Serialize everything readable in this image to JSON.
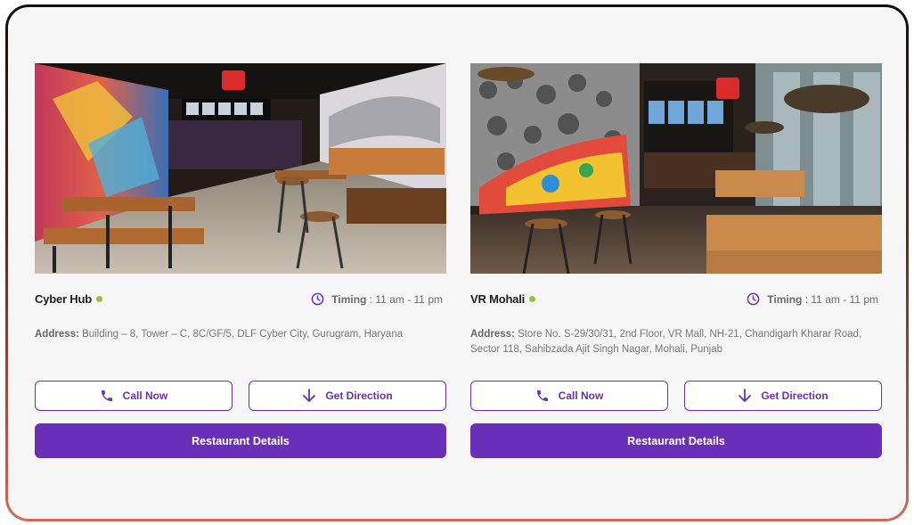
{
  "colors": {
    "accent": "#6a2fb8",
    "status_open": "#8cc63f",
    "card_bg": "#f6f6f6"
  },
  "stores": [
    {
      "name": "Cyber Hub",
      "timing_label": "Timing",
      "timing_value": ": 11 am - 11 pm",
      "address_label": "Address:",
      "address": "Building – 8, Tower – C, 8C/GF/5, DLF Cyber City, Gurugram, Haryana",
      "call_label": "Call Now",
      "direction_label": "Get Direction",
      "details_label": "Restaurant Details",
      "icons": {
        "call": "phone-icon",
        "direction": "arrow-down-icon",
        "timing": "clock-icon"
      }
    },
    {
      "name": "VR Mohali",
      "timing_label": "Timing",
      "timing_value": ": 11 am - 11 pm",
      "address_label": "Address:",
      "address": "Store No. S-29/30/31, 2nd Floor, VR Mall, NH-21, Chandigarh Kharar Road, Sector 118, Sahibzada Ajit Singh Nagar, Mohali, Punjab",
      "call_label": "Call Now",
      "direction_label": "Get Direction",
      "details_label": "Restaurant Details",
      "icons": {
        "call": "phone-icon",
        "direction": "arrow-down-icon",
        "timing": "clock-icon"
      }
    }
  ]
}
